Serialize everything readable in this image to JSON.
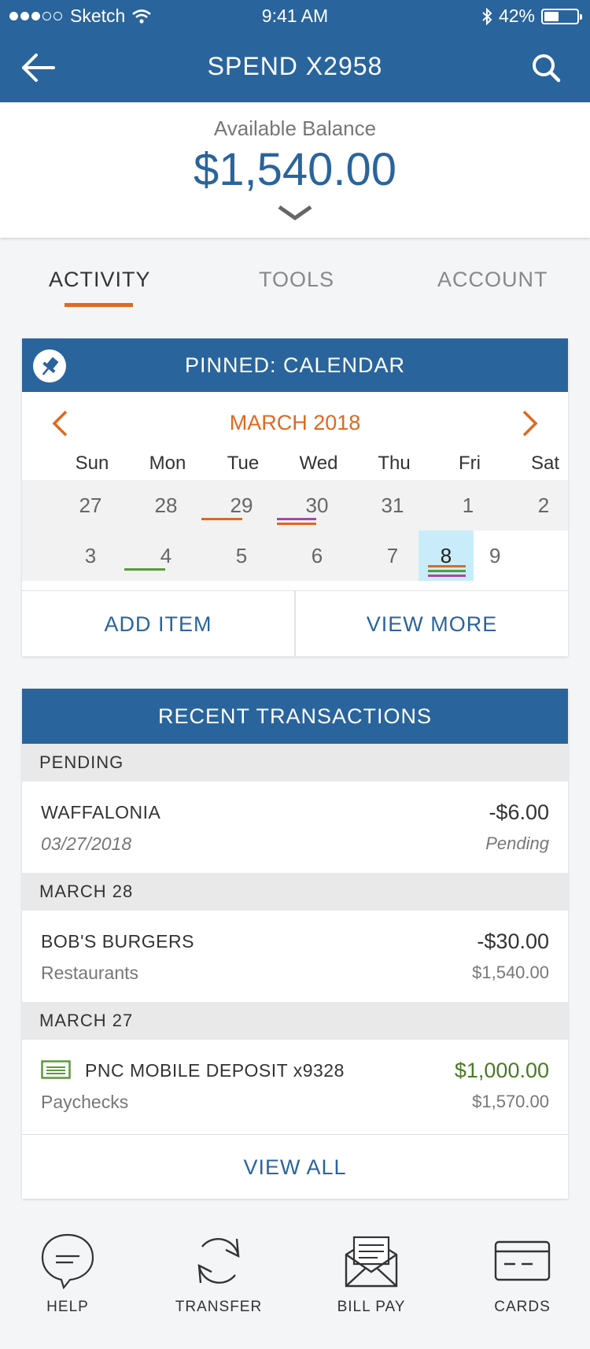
{
  "status_bar": {
    "carrier": "Sketch",
    "time": "9:41 AM",
    "battery": "42%"
  },
  "header": {
    "title": "SPEND X2958"
  },
  "balance": {
    "label": "Available Balance",
    "amount": "$1,540.00"
  },
  "tabs": [
    {
      "label": "ACTIVITY",
      "active": true
    },
    {
      "label": "TOOLS",
      "active": false
    },
    {
      "label": "ACCOUNT",
      "active": false
    }
  ],
  "calendar_card": {
    "title": "PINNED: CALENDAR",
    "month": "MARCH 2018",
    "weekdays": [
      "Sun",
      "Mon",
      "Tue",
      "Wed",
      "Thu",
      "Fri",
      "Sat"
    ],
    "week1": [
      "27",
      "28",
      "29",
      "30",
      "31",
      "1",
      "2"
    ],
    "week2": [
      "3",
      "4",
      "5",
      "6",
      "7",
      "8",
      "9"
    ],
    "selected_day": "8",
    "add_item": "ADD ITEM",
    "view_more": "VIEW MORE",
    "colors": {
      "orange": "#e06820",
      "purple": "#a14aa8",
      "green": "#5a9b3a"
    }
  },
  "transactions_card": {
    "title": "RECENT TRANSACTIONS",
    "groups": [
      {
        "header": "PENDING",
        "items": [
          {
            "name": "WAFFALONIA",
            "sub": "03/27/2018",
            "amount": "-$6.00",
            "sub2": "Pending"
          }
        ]
      },
      {
        "header": "MARCH 28",
        "items": [
          {
            "name": "BOB'S BURGERS",
            "sub": "Restaurants",
            "amount": "-$30.00",
            "sub2": "$1,540.00"
          }
        ]
      },
      {
        "header": "MARCH 27",
        "items": [
          {
            "name": "PNC MOBILE DEPOSIT x9328",
            "sub": "Paychecks",
            "amount": "$1,000.00",
            "sub2": "$1,570.00"
          }
        ]
      }
    ],
    "view_all": "VIEW ALL"
  },
  "bottom_bar": {
    "help": "HELP",
    "transfer": "TRANSFER",
    "bill_pay": "BILL PAY",
    "cards": "CARDS"
  },
  "theme": {
    "primary": "#2a649c",
    "accent": "#e06820",
    "positive": "#4a7a2a"
  }
}
